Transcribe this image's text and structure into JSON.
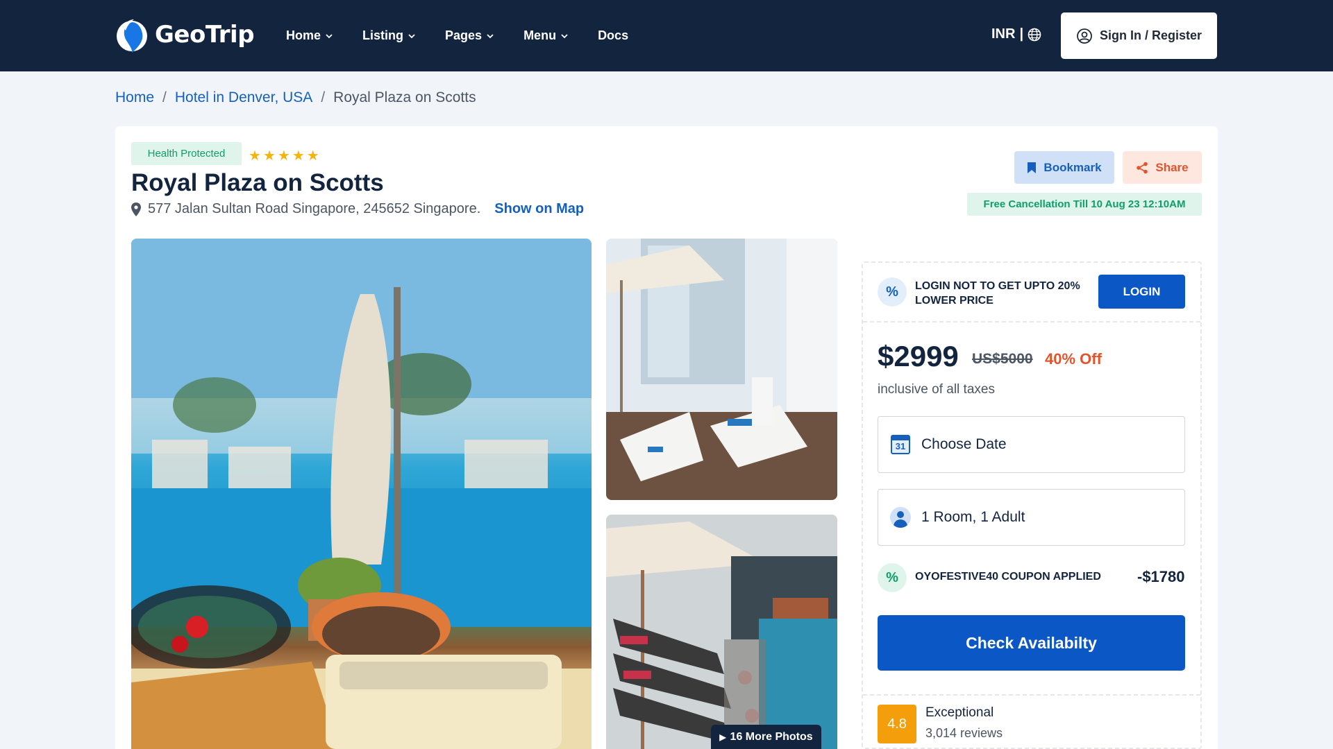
{
  "nav": {
    "logo_text": "GeoTrip",
    "items": [
      {
        "label": "Home",
        "dropdown": true
      },
      {
        "label": "Listing",
        "dropdown": true
      },
      {
        "label": "Pages",
        "dropdown": true
      },
      {
        "label": "Menu",
        "dropdown": true
      },
      {
        "label": "Docs",
        "dropdown": false
      }
    ],
    "currency": "INR",
    "currency_sep": "|",
    "signin_label": "Sign In / Register"
  },
  "breadcrumb": {
    "home": "Home",
    "sep1": "/",
    "parent": "Hotel in Denver, USA",
    "sep2": "/",
    "current": "Royal Plaza on Scotts"
  },
  "hotel": {
    "badge": "Health Protected",
    "star_count": 5,
    "star_glyph": "★",
    "name": "Royal Plaza on Scotts",
    "address": "577 Jalan Sultan Road Singapore, 245652 Singapore.",
    "map_link": "Show on Map",
    "bookmark_label": "Bookmark",
    "share_label": "Share",
    "cancellation": "Free Cancellation Till 10 Aug 23 12:10AM"
  },
  "gallery": {
    "more_photos": "16 More Photos"
  },
  "booking": {
    "promo_icon": "%",
    "promo_text": "LOGIN NOT TO GET UPTO 20% LOWER PRICE",
    "login_label": "LOGIN",
    "price": "$2999",
    "old_price": "US$5000",
    "discount": "40% Off",
    "tax_note": "inclusive of all taxes",
    "date_icon_number": "31",
    "date_label": "Choose Date",
    "guests_label": "1 Room, 1 Adult",
    "coupon_icon": "%",
    "coupon_text": "OYOFESTIVE40 COUPON APPLIED",
    "coupon_amount": "-$1780",
    "check_label": "Check Availabilty",
    "rating_score": "4.8",
    "rating_label": "Exceptional",
    "rating_count": "3,014 reviews"
  },
  "colors": {
    "navbar_bg": "#13243f",
    "primary": "#0b57c6",
    "accent_orange": "#e2542b",
    "success": "#0f9d6b",
    "rating": "#f59e0b"
  }
}
